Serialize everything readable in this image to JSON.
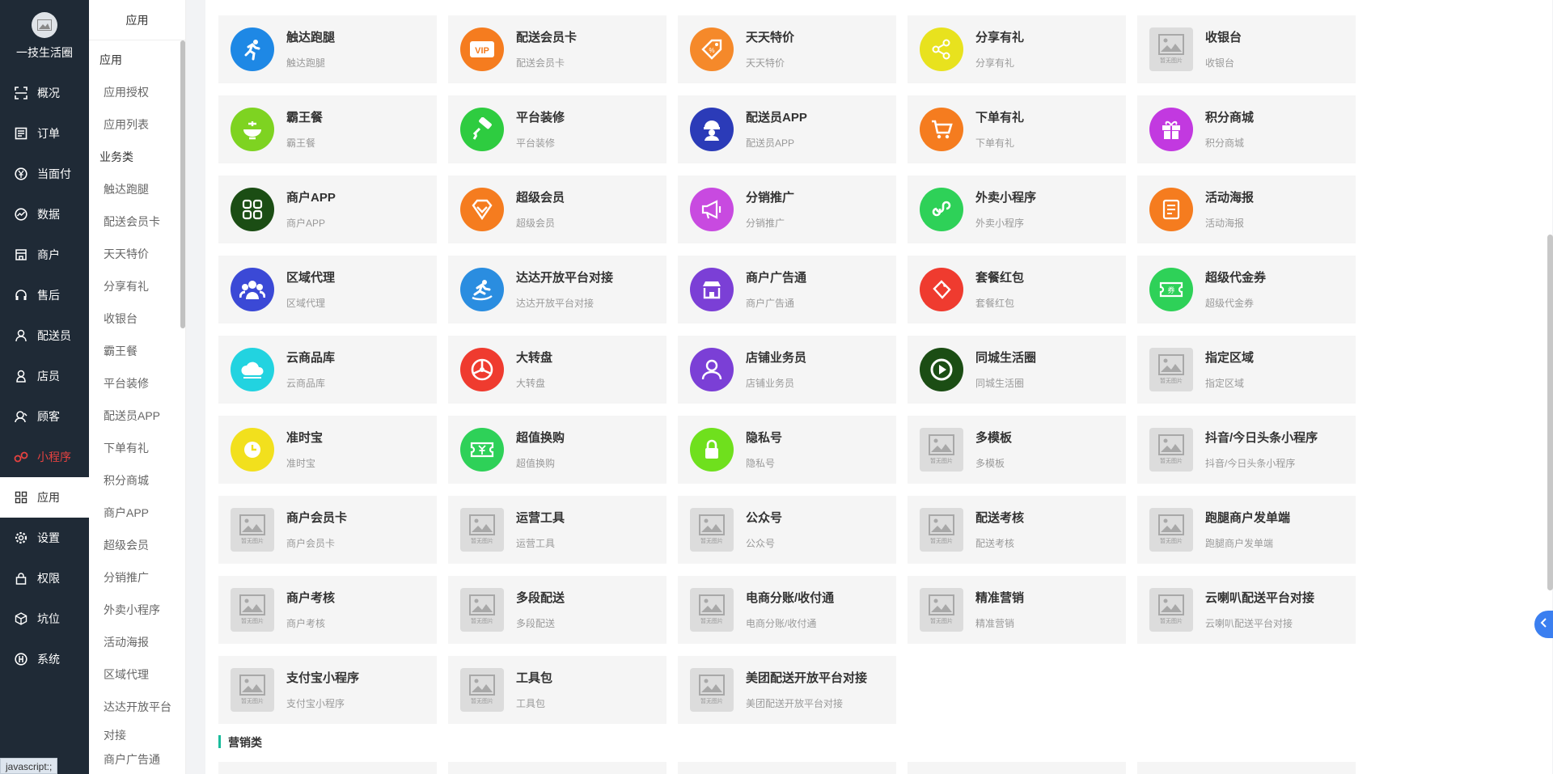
{
  "nav": {
    "brand": "一技生活圈",
    "items": [
      {
        "label": "概况",
        "icon": "overview-icon"
      },
      {
        "label": "订单",
        "icon": "order-icon"
      },
      {
        "label": "当面付",
        "icon": "yen-icon"
      },
      {
        "label": "数据",
        "icon": "chart-icon"
      },
      {
        "label": "商户",
        "icon": "shop-icon"
      },
      {
        "label": "售后",
        "icon": "headset-icon"
      },
      {
        "label": "配送员",
        "icon": "courier-icon"
      },
      {
        "label": "店员",
        "icon": "clerk-icon"
      },
      {
        "label": "顾客",
        "icon": "customer-icon"
      },
      {
        "label": "小程序",
        "icon": "miniprogram-icon"
      },
      {
        "label": "应用",
        "icon": "apps-icon"
      },
      {
        "label": "设置",
        "icon": "gear-icon"
      },
      {
        "label": "权限",
        "icon": "lock-icon"
      },
      {
        "label": "坑位",
        "icon": "box-icon"
      },
      {
        "label": "系统",
        "icon": "system-icon"
      }
    ]
  },
  "subnav": {
    "title": "应用",
    "group1": "应用",
    "links1": [
      "应用授权",
      "应用列表"
    ],
    "group2": "业务类",
    "links2": [
      "触达跑腿",
      "配送会员卡",
      "天天特价",
      "分享有礼",
      "收银台",
      "霸王餐",
      "平台装修",
      "配送员APP",
      "下单有礼",
      "积分商城",
      "商户APP",
      "超级会员",
      "分销推广",
      "外卖小程序",
      "活动海报",
      "区域代理",
      "达达开放平台"
    ],
    "link_wrap": "对接",
    "link_last": "商户广告通"
  },
  "sections": {
    "marketing": "营销类"
  },
  "cards": [
    {
      "title": "触达跑腿",
      "sub": "触达跑腿",
      "color": "#1e88e5",
      "icon": "runner-icon"
    },
    {
      "title": "配送会员卡",
      "sub": "配送会员卡",
      "color": "#f57c1f",
      "icon": "vip-icon"
    },
    {
      "title": "天天特价",
      "sub": "天天特价",
      "color": "#f5892a",
      "icon": "tag-icon"
    },
    {
      "title": "分享有礼",
      "sub": "分享有礼",
      "color": "#e8e21e",
      "icon": "share-icon"
    },
    {
      "title": "收银台",
      "sub": "收银台",
      "color": "",
      "icon": "placeholder-icon"
    },
    {
      "title": "霸王餐",
      "sub": "霸王餐",
      "color": "#7ed321",
      "icon": "dish-icon"
    },
    {
      "title": "平台装修",
      "sub": "平台装修",
      "color": "#2ecc40",
      "icon": "paint-roller-icon"
    },
    {
      "title": "配送员APP",
      "sub": "配送员APP",
      "color": "#2b3bb8",
      "icon": "courier-app-icon"
    },
    {
      "title": "下单有礼",
      "sub": "下单有礼",
      "color": "#f57c1f",
      "icon": "cart-icon"
    },
    {
      "title": "积分商城",
      "sub": "积分商城",
      "color": "#c239e0",
      "icon": "gift-icon"
    },
    {
      "title": "商户APP",
      "sub": "商户APP",
      "color": "#1b4d14",
      "icon": "grid-icon"
    },
    {
      "title": "超级会员",
      "sub": "超级会员",
      "color": "#f57c1f",
      "icon": "diamond-icon"
    },
    {
      "title": "分销推广",
      "sub": "分销推广",
      "color": "#c84ae0",
      "icon": "megaphone-icon"
    },
    {
      "title": "外卖小程序",
      "sub": "外卖小程序",
      "color": "#2ed158",
      "icon": "miniprogram-icon"
    },
    {
      "title": "活动海报",
      "sub": "活动海报",
      "color": "#f57c1f",
      "icon": "poster-icon"
    },
    {
      "title": "区域代理",
      "sub": "区域代理",
      "color": "#3b49d6",
      "icon": "group-icon"
    },
    {
      "title": "达达开放平台对接",
      "sub": "达达开放平台对接",
      "color": "#2a8de0",
      "icon": "dada-icon"
    },
    {
      "title": "商户广告通",
      "sub": "商户广告通",
      "color": "#7b3fd6",
      "icon": "store-icon"
    },
    {
      "title": "套餐红包",
      "sub": "套餐红包",
      "color": "#ef3b2f",
      "icon": "redpack-icon"
    },
    {
      "title": "超级代金券",
      "sub": "超级代金券",
      "color": "#2ed158",
      "icon": "coupon-icon"
    },
    {
      "title": "云商品库",
      "sub": "云商品库",
      "color": "#22d3e0",
      "icon": "cloud-icon"
    },
    {
      "title": "大转盘",
      "sub": "大转盘",
      "color": "#ef3b2f",
      "icon": "wheel-icon"
    },
    {
      "title": "店铺业务员",
      "sub": "店铺业务员",
      "color": "#7b3fd6",
      "icon": "person-icon"
    },
    {
      "title": "同城生活圈",
      "sub": "同城生活圈",
      "color": "#1b4d14",
      "icon": "play-icon"
    },
    {
      "title": "指定区域",
      "sub": "指定区域",
      "color": "",
      "icon": "placeholder-icon"
    },
    {
      "title": "准时宝",
      "sub": "准时宝",
      "color": "#f2e01d",
      "icon": "clock-icon"
    },
    {
      "title": "超值换购",
      "sub": "超值换购",
      "color": "#2ed158",
      "icon": "yen-ticket-icon"
    },
    {
      "title": "隐私号",
      "sub": "隐私号",
      "color": "#6fe01d",
      "icon": "lock-icon"
    },
    {
      "title": "多模板",
      "sub": "多模板",
      "color": "",
      "icon": "placeholder-icon"
    },
    {
      "title": "抖音/今日头条小程序",
      "sub": "抖音/今日头条小程序",
      "color": "",
      "icon": "placeholder-icon"
    },
    {
      "title": "商户会员卡",
      "sub": "商户会员卡",
      "color": "",
      "icon": "placeholder-icon"
    },
    {
      "title": "运营工具",
      "sub": "运营工具",
      "color": "",
      "icon": "placeholder-icon"
    },
    {
      "title": "公众号",
      "sub": "公众号",
      "color": "",
      "icon": "placeholder-icon"
    },
    {
      "title": "配送考核",
      "sub": "配送考核",
      "color": "",
      "icon": "placeholder-icon"
    },
    {
      "title": "跑腿商户发单端",
      "sub": "跑腿商户发单端",
      "color": "",
      "icon": "placeholder-icon"
    },
    {
      "title": "商户考核",
      "sub": "商户考核",
      "color": "",
      "icon": "placeholder-icon"
    },
    {
      "title": "多段配送",
      "sub": "多段配送",
      "color": "",
      "icon": "placeholder-icon"
    },
    {
      "title": "电商分账/收付通",
      "sub": "电商分账/收付通",
      "color": "",
      "icon": "placeholder-icon"
    },
    {
      "title": "精准营销",
      "sub": "精准营销",
      "color": "",
      "icon": "placeholder-icon"
    },
    {
      "title": "云喇叭配送平台对接",
      "sub": "云喇叭配送平台对接",
      "color": "",
      "icon": "placeholder-icon"
    },
    {
      "title": "支付宝小程序",
      "sub": "支付宝小程序",
      "color": "",
      "icon": "placeholder-icon"
    },
    {
      "title": "工具包",
      "sub": "工具包",
      "color": "",
      "icon": "placeholder-icon"
    },
    {
      "title": "美团配送开放平台对接",
      "sub": "美团配送开放平台对接",
      "color": "",
      "icon": "placeholder-icon"
    }
  ],
  "placeholder_text": "暂无图片",
  "status_bar": "javascript:;"
}
